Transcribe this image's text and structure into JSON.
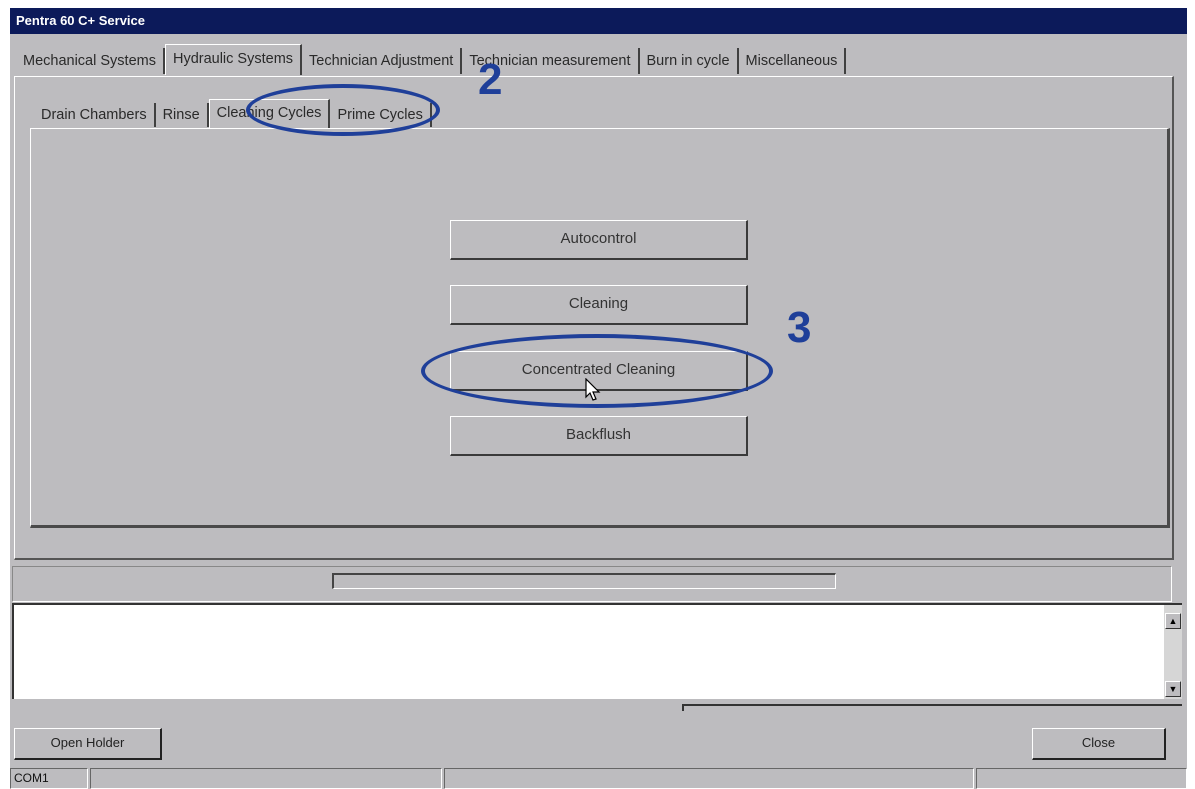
{
  "window": {
    "title": "Pentra 60 C+ Service"
  },
  "tabs": [
    {
      "label": "Mechanical Systems"
    },
    {
      "label": "Hydraulic Systems"
    },
    {
      "label": "Technician Adjustment"
    },
    {
      "label": "Technician measurement"
    },
    {
      "label": "Burn in cycle"
    },
    {
      "label": "Miscellaneous"
    }
  ],
  "active_tab": "Hydraulic Systems",
  "subtabs": [
    {
      "label": "Drain Chambers"
    },
    {
      "label": "Rinse"
    },
    {
      "label": "Cleaning Cycles"
    },
    {
      "label": "Prime Cycles"
    }
  ],
  "active_subtab": "Cleaning Cycles",
  "buttons": {
    "autocontrol": "Autocontrol",
    "cleaning": "Cleaning",
    "concentrated_cleaning": "Concentrated Cleaning",
    "backflush": "Backflush"
  },
  "footer": {
    "open_holder": "Open Holder",
    "close": "Close"
  },
  "statusbar": {
    "port": "COM1"
  },
  "annotations": {
    "step2": "2",
    "step3": "3"
  },
  "colors": {
    "titlebar": "#0c1a5a",
    "window_bg": "#bdbcbf",
    "annotation": "#1f3f99"
  }
}
